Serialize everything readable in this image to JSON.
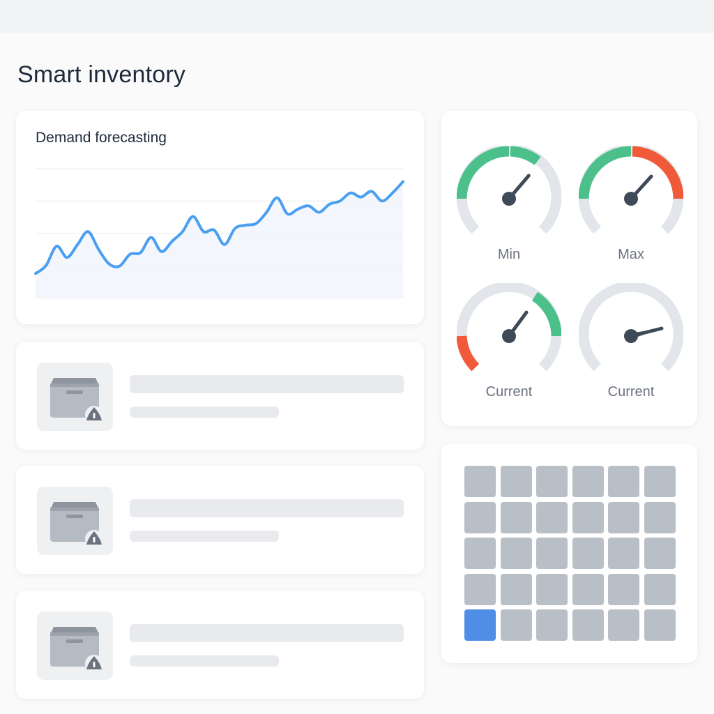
{
  "page": {
    "title": "Smart inventory"
  },
  "forecast": {
    "title": "Demand forecasting",
    "line_color": "#4a9ff0",
    "fill_color": "#eef4fc"
  },
  "chart_data": {
    "type": "line",
    "title": "Demand forecasting",
    "xlabel": "",
    "ylabel": "",
    "grid": true,
    "ylim": [
      0,
      4
    ],
    "x": [
      0,
      1,
      2,
      3,
      4,
      5,
      6,
      7,
      8,
      9,
      10,
      11,
      12,
      13,
      14,
      15,
      16,
      17,
      18,
      19,
      20,
      21,
      22,
      23,
      24,
      25,
      26,
      27,
      28,
      29,
      30,
      31,
      32,
      33,
      34,
      35
    ],
    "series": [
      {
        "values": [
          0.75,
          1.0,
          1.6,
          1.25,
          1.65,
          2.05,
          1.5,
          1.05,
          0.98,
          1.35,
          1.4,
          1.87,
          1.43,
          1.75,
          2.05,
          2.52,
          2.05,
          2.1,
          1.65,
          2.15,
          2.25,
          2.3,
          2.65,
          3.1,
          2.6,
          2.75,
          2.85,
          2.65,
          2.9,
          3.0,
          3.25,
          3.12,
          3.3,
          3.0,
          3.25,
          3.6
        ]
      }
    ]
  },
  "gauges": [
    {
      "label": "Min",
      "value_fraction": 0.72
    },
    {
      "label": "Max",
      "value_fraction": 0.72
    },
    {
      "label": "Current",
      "value_fraction": 0.72
    },
    {
      "label": "Current",
      "value_fraction": 0.92
    }
  ],
  "gauge_colors": {
    "track": "#e2e5e9",
    "good": "#4cc08b",
    "bad": "#f05a3a",
    "needle": "#3f4a58"
  },
  "inventory_items": [
    {
      "icon": "box-warning-icon"
    },
    {
      "icon": "box-warning-icon"
    },
    {
      "icon": "box-warning-icon"
    }
  ],
  "grid": {
    "rows": 5,
    "cols": 6,
    "active_row": 4,
    "active_col": 0,
    "active_color": "#4f8ee6"
  }
}
